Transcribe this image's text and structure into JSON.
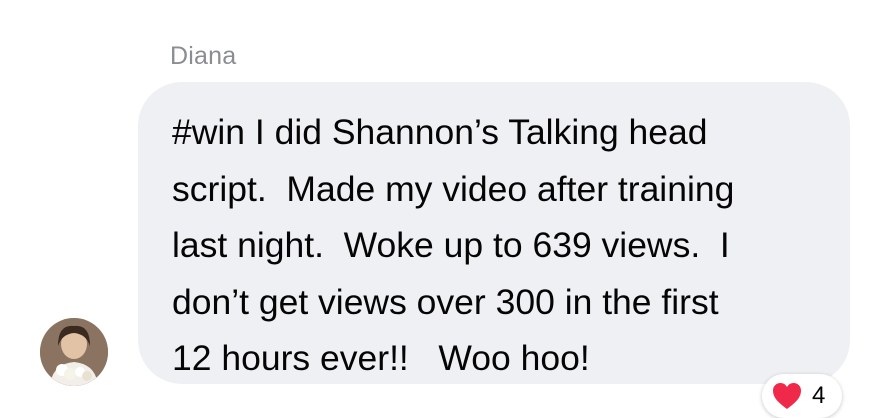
{
  "message": {
    "sender": "Diana",
    "text": "#win I did Shannon’s Talking head\nscript.  Made my video after training\nlast night.  Woke up to 639 views.  I\ndon’t get views over 300 in the first\n12 hours ever!!   Woo hoo!",
    "bubble_color": "#eef0f3",
    "reaction": {
      "icon": "heart-icon",
      "count": "4",
      "color": "#f02849"
    },
    "avatar_icon": "avatar"
  }
}
